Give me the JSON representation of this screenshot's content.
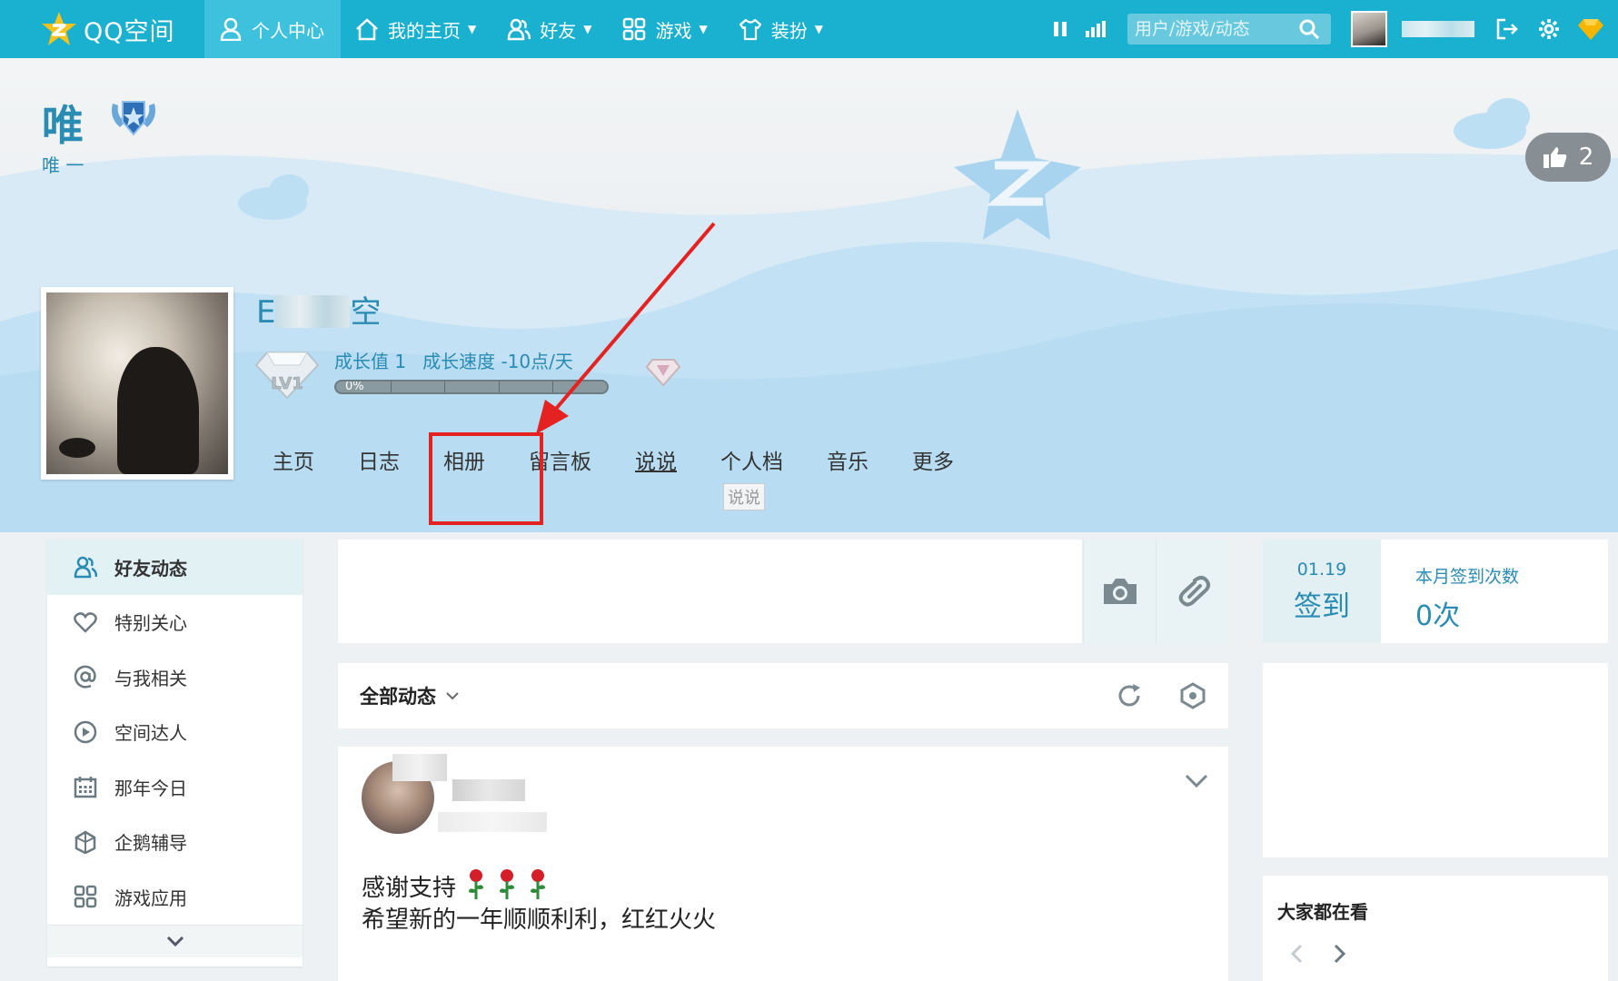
{
  "topbar": {
    "logo_text": "QQ空间",
    "nav": [
      {
        "label": "个人中心",
        "icon": "user-icon",
        "active": true
      },
      {
        "label": "我的主页",
        "icon": "home-icon",
        "caret": true
      },
      {
        "label": "好友",
        "icon": "friends-icon",
        "caret": true
      },
      {
        "label": "游戏",
        "icon": "grid-icon",
        "caret": true
      },
      {
        "label": "装扮",
        "icon": "shirt-icon",
        "caret": true
      }
    ],
    "search_placeholder": "用户/游戏/动态"
  },
  "banner": {
    "owner_name": "唯",
    "owner_subtitle": "唯 一",
    "likes": "2",
    "nickname_visible": "空",
    "nickname_prefix": "E",
    "growth_value": "成长值 1",
    "growth_speed": "成长速度 -10点/天",
    "progress_text": "0%",
    "progress": 0.0,
    "level": "LV1"
  },
  "tabs": [
    {
      "label": "主页"
    },
    {
      "label": "日志"
    },
    {
      "label": "相册"
    },
    {
      "label": "留言板"
    },
    {
      "label": "说说",
      "underline": true
    },
    {
      "label": "个人档"
    },
    {
      "label": "音乐"
    },
    {
      "label": "更多"
    }
  ],
  "tooltip": "说说",
  "sidebar": {
    "items": [
      {
        "label": "好友动态",
        "icon": "friends-icon",
        "active": true
      },
      {
        "label": "特别关心",
        "icon": "heart-icon"
      },
      {
        "label": "与我相关",
        "icon": "at-icon"
      },
      {
        "label": "空间达人",
        "icon": "play-circle-icon"
      },
      {
        "label": "那年今日",
        "icon": "calendar-icon"
      },
      {
        "label": "企鹅辅导",
        "icon": "penguin-icon"
      },
      {
        "label": "游戏应用",
        "icon": "grid-icon"
      }
    ]
  },
  "feed": {
    "filter_label": "全部动态",
    "post": {
      "line1": "感谢支持",
      "line2": "希望新的一年顺顺利利，红红火火"
    }
  },
  "signin": {
    "date": "01.19",
    "action": "签到",
    "count_label": "本月签到次数",
    "count_value": "0次"
  },
  "watching": {
    "title": "大家都在看"
  },
  "colors": {
    "topbar": "#1ab0cf",
    "accent": "#2a8bb3",
    "highlight": "#e52222"
  }
}
